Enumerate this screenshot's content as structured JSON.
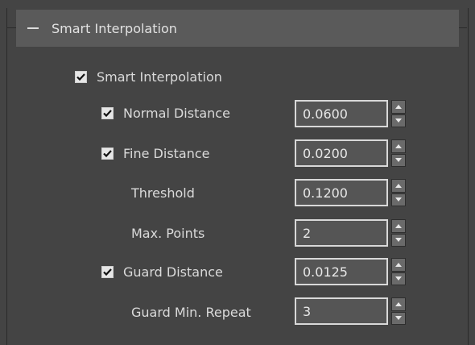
{
  "rollout": {
    "title": "Smart Interpolation",
    "collapse_icon": "minus-icon"
  },
  "smart_interpolation": {
    "label": "Smart Interpolation",
    "checked": true
  },
  "params": [
    {
      "label": "Normal Distance",
      "value": "0.0600",
      "has_checkbox": true,
      "checked": true
    },
    {
      "label": "Fine Distance",
      "value": "0.0200",
      "has_checkbox": true,
      "checked": true
    },
    {
      "label": "Threshold",
      "value": "0.1200",
      "has_checkbox": false
    },
    {
      "label": "Max. Points",
      "value": "2",
      "has_checkbox": false
    },
    {
      "label": "Guard Distance",
      "value": "0.0125",
      "has_checkbox": true,
      "checked": true
    },
    {
      "label": "Guard Min. Repeat",
      "value": "3",
      "has_checkbox": false
    }
  ],
  "colors": {
    "panel_bg": "#444444",
    "header_bg": "#5a5a5a",
    "field_bg": "#555555",
    "field_border": "#d8d8d8"
  }
}
